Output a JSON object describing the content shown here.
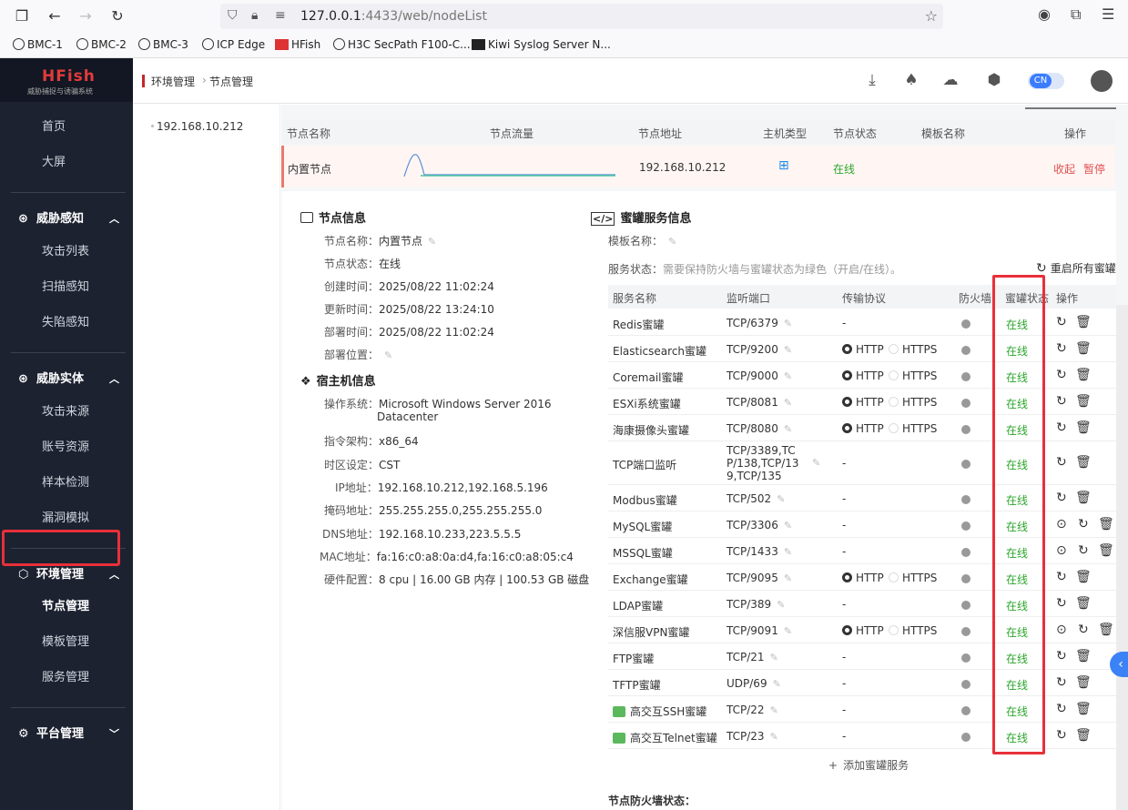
{
  "browser": {
    "url_host": "127.0.0.1",
    "url_rest": ":4433/web/nodeList",
    "bookmarks": [
      "BMC-1",
      "BMC-2",
      "BMC-3",
      "ICP Edge",
      "HFish",
      "H3C SecPath F100-C...",
      "Kiwi Syslog Server N..."
    ]
  },
  "app": {
    "logo": "HFish",
    "logo_sub": "威胁捕捉与诱骗系统",
    "lang": "CN"
  },
  "header": {
    "crumb1": "环境管理",
    "crumb_sep": "›",
    "crumb2": "节点管理"
  },
  "sidebar": {
    "home": "首页",
    "screen": "大屏",
    "group1": "威胁感知",
    "g1_items": [
      "攻击列表",
      "扫描感知",
      "失陷感知"
    ],
    "group2": "威胁实体",
    "g2_items": [
      "攻击来源",
      "账号资源",
      "样本检测",
      "漏洞模拟"
    ],
    "group3": "环境管理",
    "g3_items": [
      "节点管理",
      "模板管理",
      "服务管理"
    ],
    "group4": "平台管理"
  },
  "tree": {
    "node": "192.168.10.212"
  },
  "node_table": {
    "headers": [
      "节点名称",
      "节点流量",
      "节点地址",
      "主机类型",
      "节点状态",
      "模板名称",
      "操作"
    ],
    "row": {
      "name": "内置节点",
      "address": "192.168.10.212",
      "status": "在线",
      "collapse": "收起",
      "pause": "暂停"
    }
  },
  "node_info": {
    "title": "节点信息",
    "items": [
      {
        "k": "节点名称：",
        "v": "内置节点"
      },
      {
        "k": "节点状态：",
        "v": "在线"
      },
      {
        "k": "创建时间：",
        "v": "2025/08/22 11:02:24"
      },
      {
        "k": "更新时间：",
        "v": "2025/08/22 13:24:10"
      },
      {
        "k": "部署时间：",
        "v": "2025/08/22 11:02:24"
      },
      {
        "k": "部署位置：",
        "v": ""
      }
    ]
  },
  "host_info": {
    "title": "宿主机信息",
    "os_k": "操作系统：",
    "os_v1": "Microsoft Windows Server 2016",
    "os_v2": "Datacenter",
    "items": [
      {
        "k": "指令架构：",
        "v": "x86_64"
      },
      {
        "k": "时区设定：",
        "v": "CST"
      },
      {
        "k": "IP地址：",
        "v": "192.168.10.212,192.168.5.196"
      },
      {
        "k": "掩码地址：",
        "v": "255.255.255.0,255.255.255.0"
      },
      {
        "k": "DNS地址：",
        "v": "192.168.10.233,223.5.5.5"
      },
      {
        "k": "MAC地址：",
        "v": "fa:16:c0:a8:0a:d4,fa:16:c0:a8:05:c4"
      },
      {
        "k": "硬件配置：",
        "v": "8 cpu | 16.00 GB 内存 | 100.53 GB 磁盘"
      }
    ]
  },
  "honeypot": {
    "title": "蜜罐服务信息",
    "template_label": "模板名称：",
    "status_label": "服务状态：",
    "status_hint": "需要保持防火墙与蜜罐状态为绿色（开启/在线）。",
    "restart_all": "重启所有蜜罐",
    "headers": [
      "服务名称",
      "监听端口",
      "传输协议",
      "防火墙",
      "蜜罐状态",
      "操作"
    ],
    "http": "HTTP",
    "https": "HTTPS",
    "rows": [
      {
        "name": "Redis蜜罐",
        "port": "TCP/6379",
        "proto": "-",
        "status": "在线"
      },
      {
        "name": "Elasticsearch蜜罐",
        "port": "TCP/9200",
        "proto": "http",
        "status": "在线"
      },
      {
        "name": "Coremail蜜罐",
        "port": "TCP/9000",
        "proto": "http",
        "status": "在线"
      },
      {
        "name": "ESXi系统蜜罐",
        "port": "TCP/8081",
        "proto": "http",
        "status": "在线"
      },
      {
        "name": "海康摄像头蜜罐",
        "port": "TCP/8080",
        "proto": "http",
        "status": "在线"
      },
      {
        "name": "TCP端口监听",
        "port": "TCP/3389,TCP/138,TCP/139,TCP/135",
        "port_lines": [
          "TCP/3389,TC",
          "P/138,TCP/13",
          "9,TCP/135"
        ],
        "proto": "-",
        "status": "在线"
      },
      {
        "name": "Modbus蜜罐",
        "port": "TCP/502",
        "proto": "-",
        "status": "在线"
      },
      {
        "name": "MySQL蜜罐",
        "port": "TCP/3306",
        "proto": "-",
        "status": "在线",
        "extra": true
      },
      {
        "name": "MSSQL蜜罐",
        "port": "TCP/1433",
        "proto": "-",
        "status": "在线",
        "extra": true
      },
      {
        "name": "Exchange蜜罐",
        "port": "TCP/9095",
        "proto": "http",
        "status": "在线"
      },
      {
        "name": "LDAP蜜罐",
        "port": "TCP/389",
        "proto": "-",
        "status": "在线"
      },
      {
        "name": "深信服VPN蜜罐",
        "port": "TCP/9091",
        "proto": "http",
        "status": "在线",
        "extra": true
      },
      {
        "name": "FTP蜜罐",
        "port": "TCP/21",
        "proto": "-",
        "status": "在线"
      },
      {
        "name": "TFTP蜜罐",
        "port": "UDP/69",
        "proto": "-",
        "status": "在线"
      },
      {
        "name": "高交互SSH蜜罐",
        "port": "TCP/22",
        "proto": "-",
        "status": "在线",
        "hi": true
      },
      {
        "name": "高交互Telnet蜜罐",
        "port": "TCP/23",
        "proto": "-",
        "status": "在线",
        "hi": true
      }
    ],
    "add_service": "添加蜜罐服务",
    "fw_status_label": "节点防火墙状态："
  },
  "colors": {
    "online": "#2ba52b",
    "danger": "#e05050",
    "highlight": "#e8303a"
  }
}
